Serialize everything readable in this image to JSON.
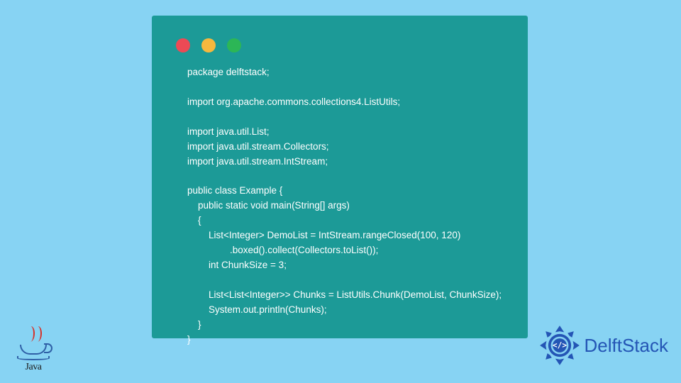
{
  "code": {
    "lines": [
      "package delftstack;",
      "",
      "import org.apache.commons.collections4.ListUtils;",
      "",
      "import java.util.List;",
      "import java.util.stream.Collectors;",
      "import java.util.stream.IntStream;",
      "",
      "public class Example {",
      "    public static void main(String[] args)",
      "    {",
      "        List<Integer> DemoList = IntStream.rangeClosed(100, 120)",
      "                .boxed().collect(Collectors.toList());",
      "        int ChunkSize = 3;",
      "",
      "        List<List<Integer>> Chunks = ListUtils.Chunk(DemoList, ChunkSize);",
      "        System.out.println(Chunks);",
      "    }",
      "}"
    ]
  },
  "logos": {
    "java_label": "Java",
    "delftstack_label": "DelftStack"
  },
  "colors": {
    "background": "#87d3f3",
    "window": "#1c9a97",
    "code_text": "#ffffff",
    "dot_red": "#ec4a55",
    "dot_yellow": "#f6b83e",
    "dot_green": "#2cb656",
    "delft_blue": "#2455b5",
    "java_red": "#d73027",
    "java_blue": "#2f5fa6"
  }
}
